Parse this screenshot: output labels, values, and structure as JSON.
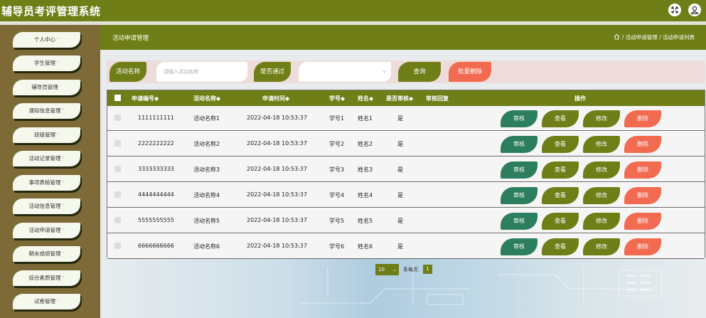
{
  "app": {
    "title": "辅导员考评管理系统"
  },
  "sidebar": {
    "items": [
      {
        "label": "个人中心"
      },
      {
        "label": "学生管理"
      },
      {
        "label": "辅导员管理"
      },
      {
        "label": "通知信息管理"
      },
      {
        "label": "班级管理"
      },
      {
        "label": "活动记录管理"
      },
      {
        "label": "事项表格管理"
      },
      {
        "label": "活动信息管理"
      },
      {
        "label": "活动申请管理"
      },
      {
        "label": "期末成绩管理"
      },
      {
        "label": "综合素质管理"
      },
      {
        "label": "试卷管理"
      }
    ],
    "caret": "˅"
  },
  "header": {
    "title": "活动申请管理",
    "breadcrumb": "/ 活动申请管理 / 活动申请列表"
  },
  "search": {
    "name_label": "活动名称",
    "name_placeholder": "请输入活动名称",
    "pass_label": "是否通过",
    "pass_value": "",
    "query_button": "查询",
    "batch_delete_button": "批量删除"
  },
  "table": {
    "headers": [
      "申请编号◆",
      "活动名称◆",
      "申请时间◆",
      "学号◆",
      "姓名◆",
      "是否审核◆",
      "审核回复",
      "操作"
    ],
    "rows": [
      {
        "id": "1111111111",
        "name": "活动名称1",
        "time": "2022-04-18 10:53:37",
        "sno": "学号1",
        "sname": "姓名1",
        "audited": "是",
        "reply": ""
      },
      {
        "id": "2222222222",
        "name": "活动名称2",
        "time": "2022-04-18 10:53:37",
        "sno": "学号2",
        "sname": "姓名2",
        "audited": "是",
        "reply": ""
      },
      {
        "id": "3333333333",
        "name": "活动名称3",
        "time": "2022-04-18 10:53:37",
        "sno": "学号3",
        "sname": "姓名3",
        "audited": "是",
        "reply": ""
      },
      {
        "id": "4444444444",
        "name": "活动名称4",
        "time": "2022-04-18 10:53:37",
        "sno": "学号4",
        "sname": "姓名4",
        "audited": "是",
        "reply": ""
      },
      {
        "id": "5555555555",
        "name": "活动名称5",
        "time": "2022-04-18 10:53:37",
        "sno": "学号5",
        "sname": "姓名5",
        "audited": "是",
        "reply": ""
      },
      {
        "id": "6666666666",
        "name": "活动名称6",
        "time": "2022-04-18 10:53:37",
        "sno": "学号6",
        "sname": "姓名6",
        "audited": "是",
        "reply": ""
      }
    ],
    "actions": {
      "audit": "审核",
      "view": "查看",
      "edit": "修改",
      "delete": "删除"
    }
  },
  "pagination": {
    "page_size": "10",
    "page_size_label": "条每页",
    "current_page": "1"
  },
  "icons": {
    "fullscreen": "fullscreen-icon",
    "user": "user-icon",
    "home": "home-icon"
  },
  "colors": {
    "primary": "#6f7e16",
    "sidebar": "#7d6a37",
    "audit": "#2d7e5e",
    "danger": "#f26a4f"
  }
}
